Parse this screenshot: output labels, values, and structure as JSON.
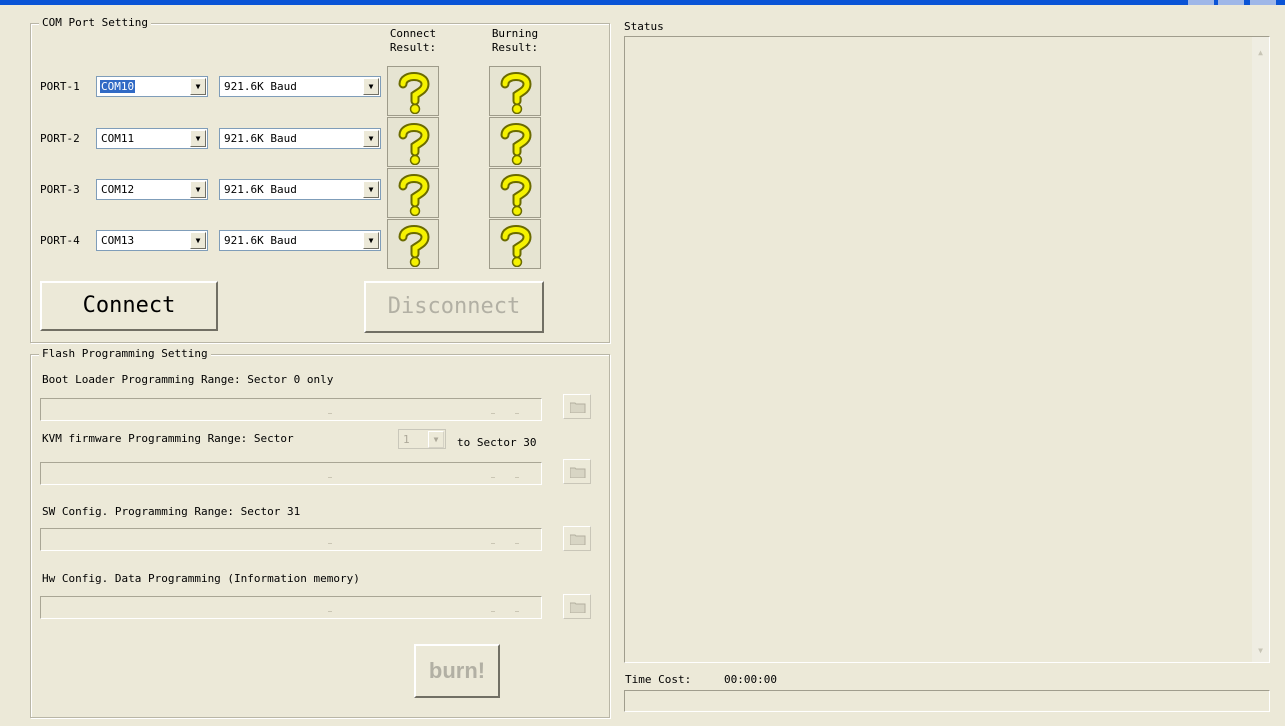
{
  "com_port_group": {
    "title": "COM Port Setting",
    "connect_result_header": [
      "Connect",
      "Result:"
    ],
    "burning_result_header": [
      "Burning",
      "Result:"
    ],
    "ports": [
      {
        "label": "PORT-1",
        "com": "COM10",
        "baud": "921.6K Baud",
        "com_selected": true
      },
      {
        "label": "PORT-2",
        "com": "COM11",
        "baud": "921.6K Baud",
        "com_selected": false
      },
      {
        "label": "PORT-3",
        "com": "COM12",
        "baud": "921.6K Baud",
        "com_selected": false
      },
      {
        "label": "PORT-4",
        "com": "COM13",
        "baud": "921.6K Baud",
        "com_selected": false
      }
    ],
    "result_icon": "question-mark-icon",
    "connect_button": "Connect",
    "disconnect_button": "Disconnect"
  },
  "flash_group": {
    "title": "Flash Programming Setting",
    "boot_loader_label": "Boot Loader Programming Range: Sector 0 only",
    "kvm_label": "KVM firmware Programming Range: Sector",
    "kvm_sector_value": "1",
    "kvm_to_label": "to Sector 30",
    "sw_config_label": "SW Config. Programming Range: Sector 31",
    "hw_config_label": "Hw Config. Data Programming  (Information memory)",
    "browse_icon": "folder-icon",
    "burn_button": "burn!"
  },
  "status_panel": {
    "title": "Status",
    "time_cost_label": "Time Cost:",
    "time_cost_value": "00:00:00"
  },
  "colors": {
    "window_bg": "#ece9d8",
    "title_bar": "#0a54d6",
    "selection": "#316ac5",
    "icon_yellow": "#f5f200"
  }
}
